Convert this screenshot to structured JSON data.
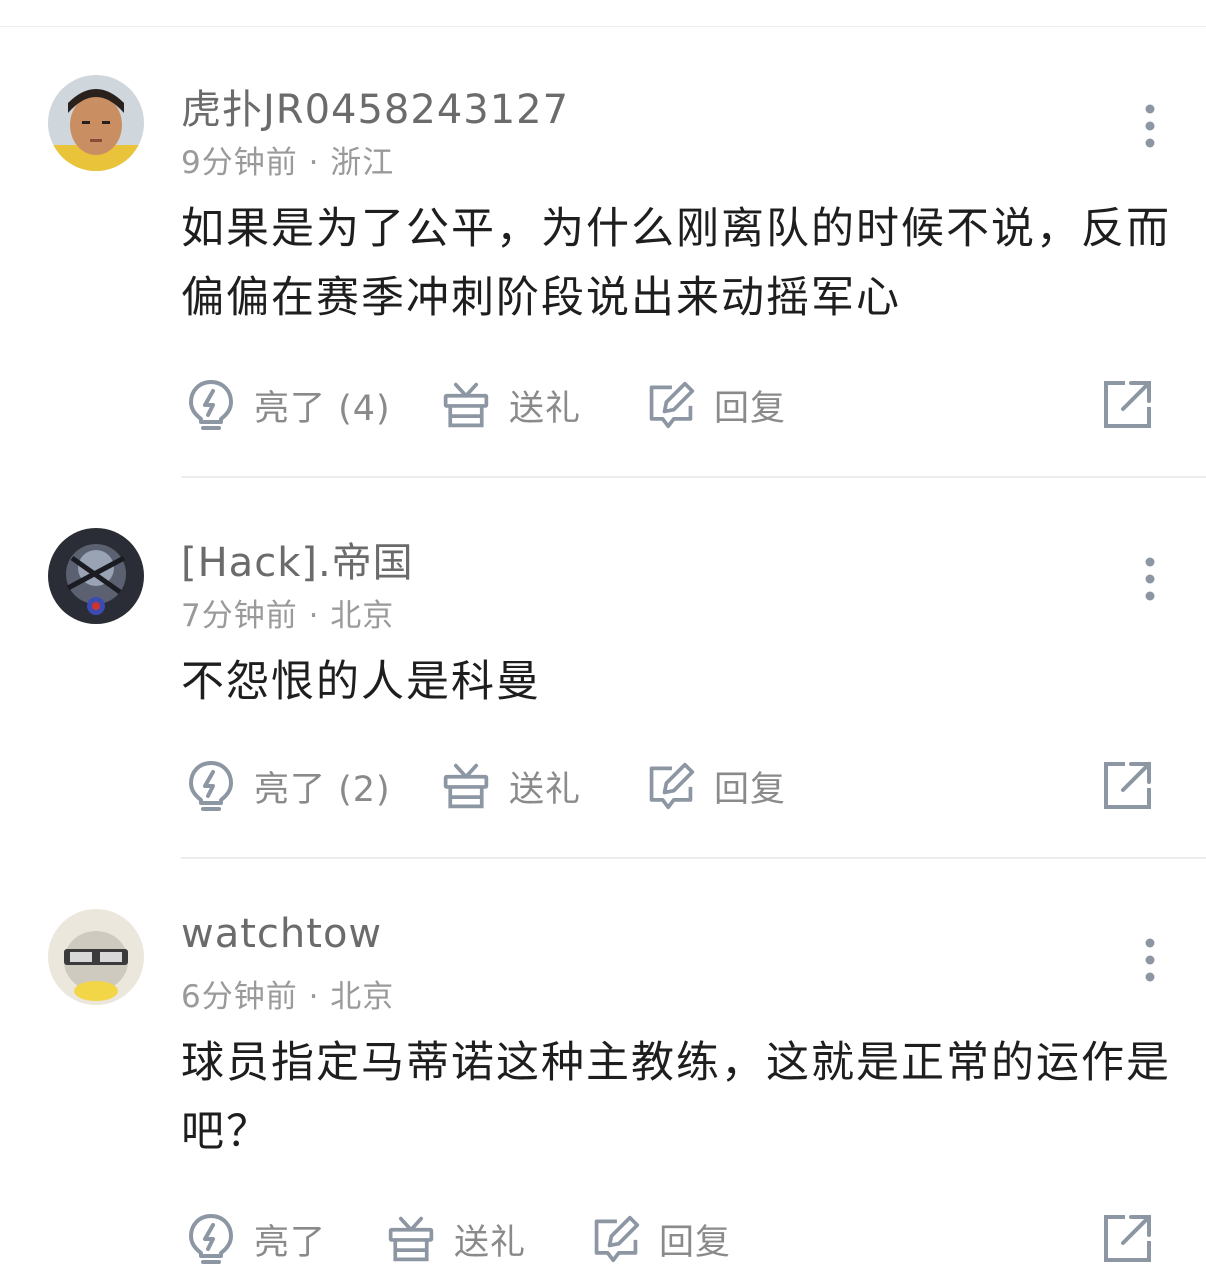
{
  "comments": [
    {
      "username": "虎扑JR0458243127",
      "time": "9分钟前",
      "location": "浙江",
      "content": "如果是为了公平，为什么刚离队的时候不说，反而偏偏在赛季冲刺阶段说出来动摇军心",
      "like_label": "亮了 (4)",
      "gift_label": "送礼",
      "reply_label": "回复"
    },
    {
      "username": "[Hack].帝国",
      "time": "7分钟前",
      "location": "北京",
      "content": "不怨恨的人是科曼",
      "like_label": "亮了 (2)",
      "gift_label": "送礼",
      "reply_label": "回复"
    },
    {
      "username": "watchtow",
      "time": "6分钟前",
      "location": "北京",
      "content": "球员指定马蒂诺这种主教练，这就是正常的运作是吧？",
      "like_label": "亮了",
      "gift_label": "送礼",
      "reply_label": "回复"
    }
  ],
  "meta_separator": " · ",
  "icons": {
    "like": "lightbulb-icon",
    "gift": "gift-icon",
    "reply": "edit-reply-icon",
    "share": "share-icon",
    "more": "more-vertical-icon"
  },
  "colors": {
    "icon": "#8d96a3",
    "username": "#6b6b6b",
    "meta": "#9a9a9a",
    "text": "#1e1e1e",
    "divider": "#ededed"
  }
}
